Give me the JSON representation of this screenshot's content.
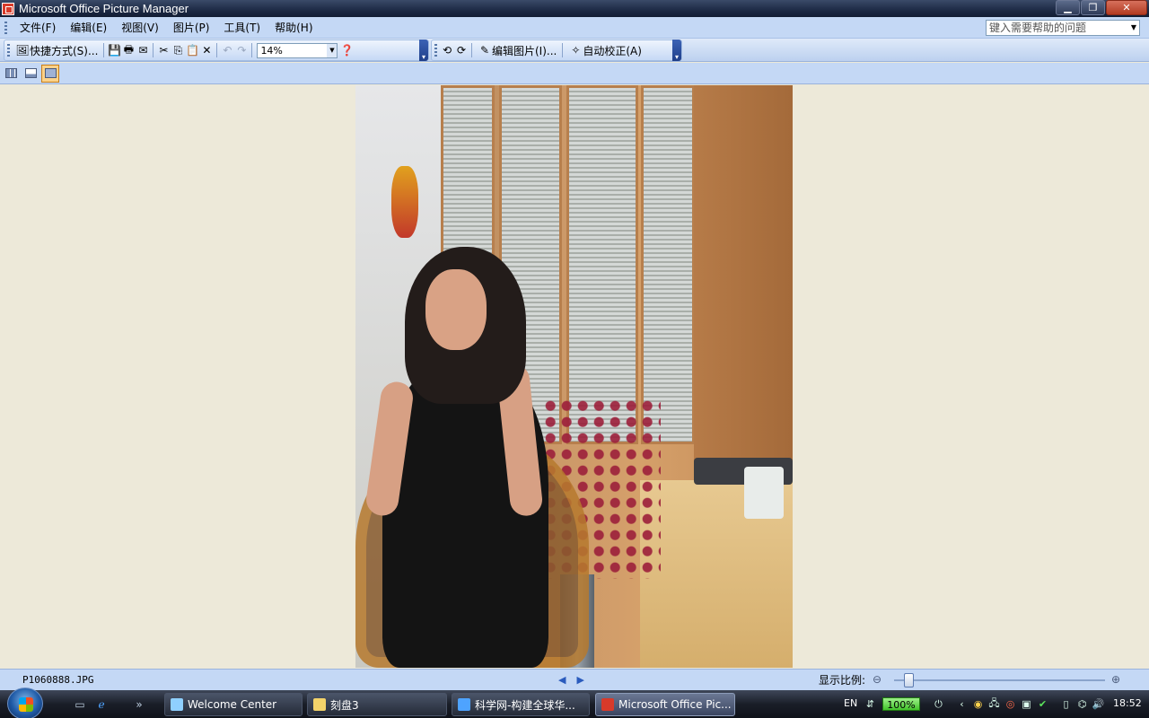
{
  "window": {
    "title": "Microsoft Office Picture Manager",
    "min_label": "▁",
    "max_label": "❐",
    "close_label": "✕"
  },
  "menu": {
    "items": [
      "文件(F)",
      "编辑(E)",
      "视图(V)",
      "图片(P)",
      "工具(T)",
      "帮助(H)"
    ],
    "help_placeholder": "键入需要帮助的问题"
  },
  "toolbar": {
    "shortcuts_label": "快捷方式(S)...",
    "zoom_value": "14%",
    "edit_picture_label": "编辑图片(I)...",
    "auto_correct_label": "自动校正(A)"
  },
  "status": {
    "filename": "P1060888.JPG",
    "prev_arrow": "◀",
    "next_arrow": "▶",
    "zoom_label": "显示比例:",
    "zoom_level_fraction": 0.05
  },
  "taskbar": {
    "tasks": [
      {
        "label": "Welcome Center"
      },
      {
        "label": "刻盘3"
      },
      {
        "label": "科学网-构建全球华..."
      },
      {
        "label": "Microsoft Office Pic..."
      }
    ],
    "language": "EN",
    "battery": "100%",
    "clock": "18:52",
    "expand_glyph": "»"
  },
  "colors": {
    "menu_bg": "#c4d8f5",
    "canvas_bg": "#ede9d9",
    "accent": "#2a5bbd",
    "close_btn": "#c0442b"
  }
}
